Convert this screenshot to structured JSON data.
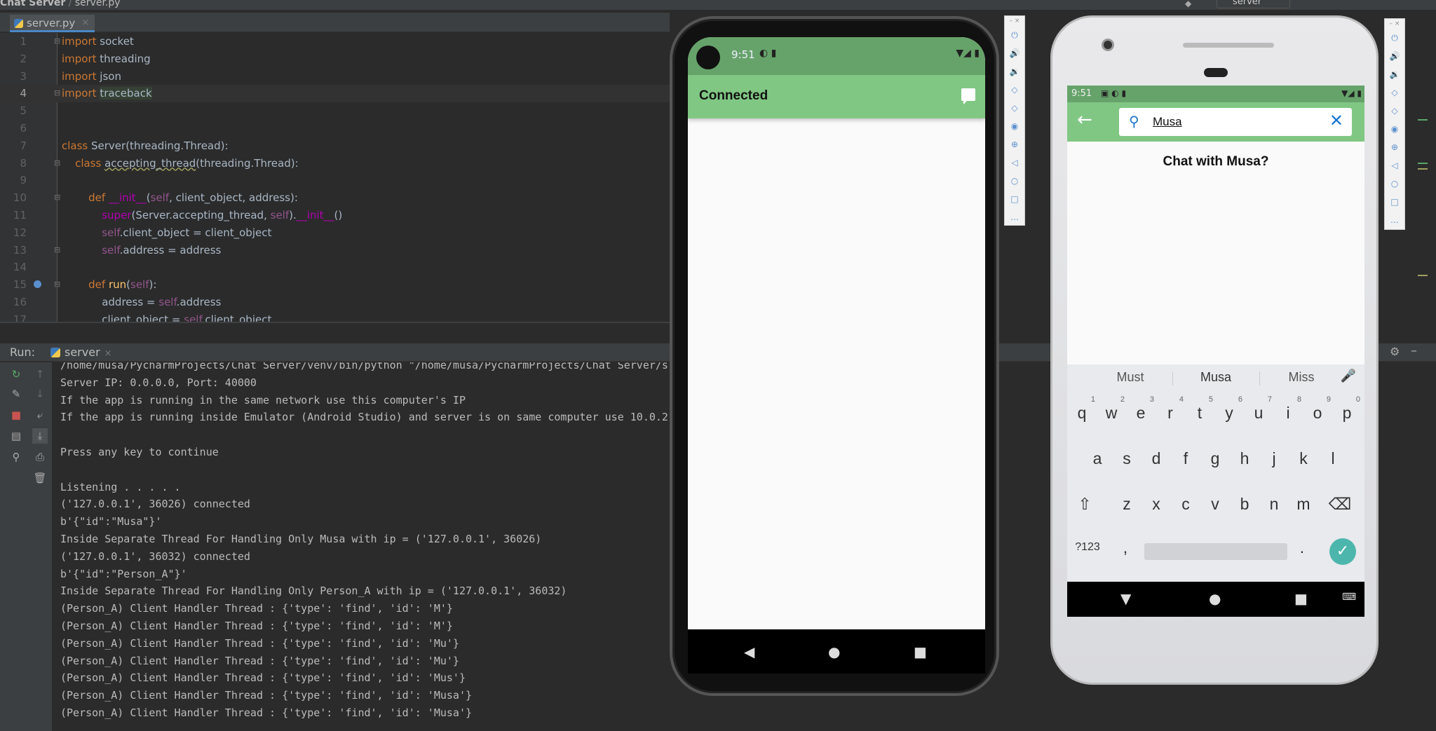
{
  "window": {
    "project": "Chat Server",
    "file_crumb": "server.py",
    "run_config": "server"
  },
  "editor": {
    "tab_label": "server.py",
    "lines": [
      {
        "n": "1"
      },
      {
        "n": "2"
      },
      {
        "n": "3"
      },
      {
        "n": "4"
      },
      {
        "n": "5"
      },
      {
        "n": "6"
      },
      {
        "n": "7"
      },
      {
        "n": "8"
      },
      {
        "n": "9"
      },
      {
        "n": "10"
      },
      {
        "n": "11"
      },
      {
        "n": "12"
      },
      {
        "n": "13"
      },
      {
        "n": "14"
      },
      {
        "n": "15"
      },
      {
        "n": "16"
      },
      {
        "n": "17"
      }
    ],
    "code": {
      "l1": [
        "import",
        " socket"
      ],
      "l2": [
        "import",
        " threading"
      ],
      "l3": [
        "import",
        " json"
      ],
      "l4": [
        "import",
        " ",
        "traceback"
      ],
      "l7": [
        "class",
        " Server(threading.Thread):"
      ],
      "l8": [
        "class",
        " ",
        "accepting_thread",
        "(threading.Thread):"
      ],
      "l10": [
        "def",
        " ",
        "__init__",
        "(",
        "self",
        ", client_object, address):"
      ],
      "l11": [
        "super",
        "(Server.accepting_thread, ",
        "self",
        ").",
        "__init__",
        "()"
      ],
      "l12": [
        "self",
        ".client_object = client_object"
      ],
      "l13": [
        "self",
        ".address = address"
      ],
      "l15": [
        "def",
        " ",
        "run",
        "(",
        "self",
        "):"
      ],
      "l16": [
        "address = ",
        "self",
        ".address"
      ],
      "l17": [
        "client_object = ",
        "self",
        ".client_object"
      ]
    }
  },
  "run_panel": {
    "label": "Run:",
    "tab": "server",
    "console": [
      "/home/musa/PycharmProjects/Chat Server/venv/bin/python \"/home/musa/PycharmProjects/Chat Server/s",
      "Server IP: 0.0.0.0, Port: 40000",
      "If the app is running in the same network use this computer's IP",
      "If the app is running inside Emulator (Android Studio) and server is on same computer use 10.0.2.",
      "",
      "Press any key to continue",
      "",
      "Listening . . . . .",
      "('127.0.0.1', 36026) connected",
      "b'{\"id\":\"Musa\"}'",
      "Inside Separate Thread For Handling Only Musa with ip = ('127.0.0.1', 36026)",
      "('127.0.0.1', 36032) connected",
      "b'{\"id\":\"Person_A\"}'",
      "Inside Separate Thread For Handling Only Person_A with ip = ('127.0.0.1', 36032)",
      "(Person_A) Client Handler Thread : {'type': 'find', 'id': 'M'}",
      "(Person_A) Client Handler Thread : {'type': 'find', 'id': 'M'}",
      "(Person_A) Client Handler Thread : {'type': 'find', 'id': 'Mu'}",
      "(Person_A) Client Handler Thread : {'type': 'find', 'id': 'Mu'}",
      "(Person_A) Client Handler Thread : {'type': 'find', 'id': 'Mus'}",
      "(Person_A) Client Handler Thread : {'type': 'find', 'id': 'Musa'}",
      "(Person_A) Client Handler Thread : {'type': 'find', 'id': 'Musa'}"
    ]
  },
  "phone1": {
    "time": "9:51",
    "title": "Connected"
  },
  "phone2": {
    "time": "9:51",
    "search_value": "Musa",
    "prompt": "Chat with Musa?",
    "suggestions": [
      "Must",
      "Musa",
      "Miss"
    ],
    "row1": [
      "q",
      "w",
      "e",
      "r",
      "t",
      "y",
      "u",
      "i",
      "o",
      "p"
    ],
    "row1_nums": [
      "1",
      "2",
      "3",
      "4",
      "5",
      "6",
      "7",
      "8",
      "9",
      "0"
    ],
    "row2": [
      "a",
      "s",
      "d",
      "f",
      "g",
      "h",
      "j",
      "k",
      "l"
    ],
    "row3": [
      "z",
      "x",
      "c",
      "v",
      "b",
      "n",
      "m"
    ],
    "sym_key": "?123",
    "comma": ",",
    "period": "."
  },
  "colors": {
    "ide_bg": "#2b2b2b",
    "keyword": "#cc7832",
    "self": "#94558d",
    "appbar": "#81c784",
    "statusbar": "#66a36a",
    "accent_blue": "#1976d2"
  }
}
